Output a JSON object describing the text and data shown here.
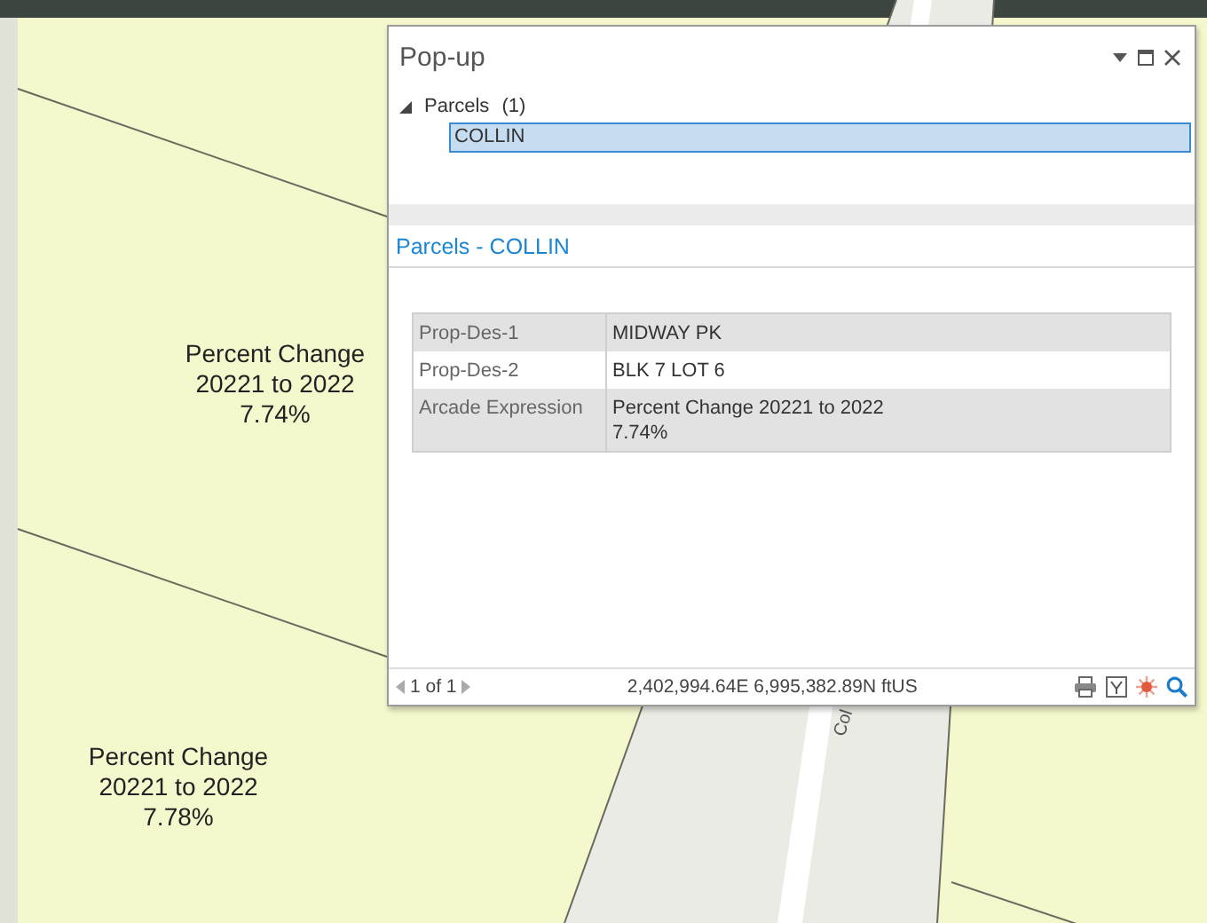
{
  "map": {
    "labels": [
      {
        "kind": "parcel",
        "text": "Percent Change\n20221 to 2022\n7.74%"
      },
      {
        "kind": "parcel",
        "text": "Percent Change\n20221 to 2022\n7.78%"
      },
      {
        "kind": "road",
        "text": "Col"
      }
    ]
  },
  "popup": {
    "title": "Pop-up",
    "tree": [
      {
        "label": "Parcels",
        "count": "(1)",
        "expanded": true,
        "children": [
          {
            "label": "COLLIN",
            "selected": true
          }
        ]
      }
    ],
    "section_title": "Parcels - COLLIN",
    "rows": [
      {
        "field": "Prop-Des-1",
        "value": "MIDWAY PK"
      },
      {
        "field": "Prop-Des-2",
        "value": "BLK 7 LOT 6"
      },
      {
        "field": "Arcade Expression",
        "value": "Percent Change 20221 to 2022\n7.74%"
      }
    ],
    "footer": {
      "page": "1 of 1",
      "coordinates": "2,402,994.64E 6,995,382.89N ftUS"
    }
  }
}
